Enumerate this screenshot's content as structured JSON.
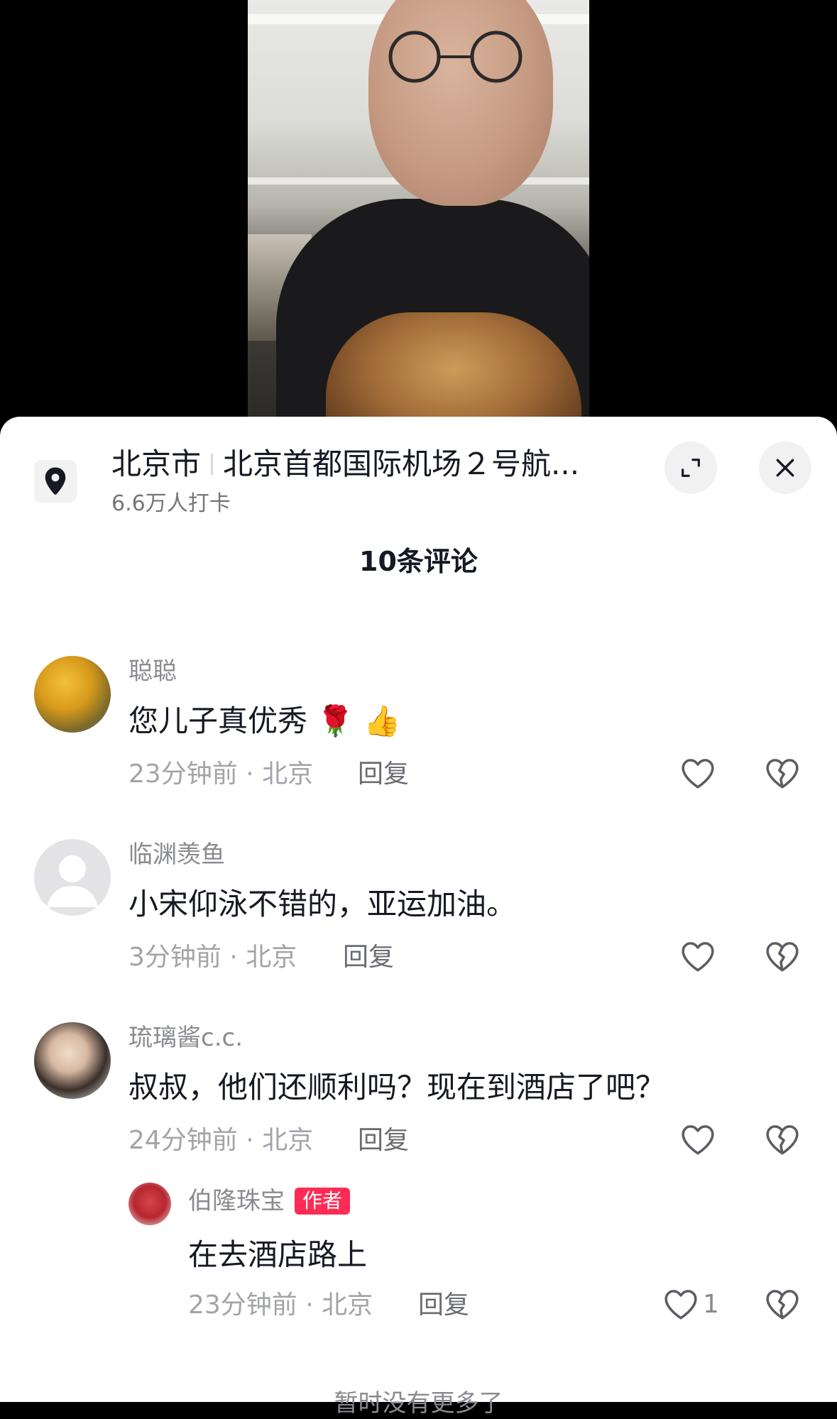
{
  "location": {
    "city": "北京市",
    "place": "北京首都国际机场２号航...",
    "checkins": "6.6万人打卡"
  },
  "comments_header": {
    "count_label": "10条评论"
  },
  "comments": [
    {
      "user": "聪聪",
      "text": "您儿子真优秀 🌹 👍",
      "time_location": "23分钟前 · 北京",
      "reply_label": "回复",
      "likes": ""
    },
    {
      "user": "临渊羡鱼",
      "text": "小宋仰泳不错的，亚运加油。",
      "time_location": "3分钟前 · 北京",
      "reply_label": "回复",
      "likes": ""
    },
    {
      "user": "琉璃酱c.c.",
      "text": "叔叔，他们还顺利吗？现在到酒店了吧？",
      "time_location": "24分钟前 · 北京",
      "reply_label": "回复",
      "likes": ""
    }
  ],
  "reply": {
    "user": "伯隆珠宝",
    "badge": "作者",
    "text": "在去酒店路上",
    "time_location": "23分钟前 · 北京",
    "reply_label": "回复",
    "likes": "1"
  },
  "footer": {
    "no_more": "暂时没有更多了"
  },
  "icons": {
    "location": "location-pin-icon",
    "expand": "expand-icon",
    "close": "close-icon",
    "like": "heart-outline-icon",
    "dislike": "broken-heart-icon"
  },
  "colors": {
    "text_primary": "#161823",
    "text_secondary": "#8a8b91",
    "author_badge": "#fe2c55",
    "sheet_bg": "#ffffff"
  }
}
